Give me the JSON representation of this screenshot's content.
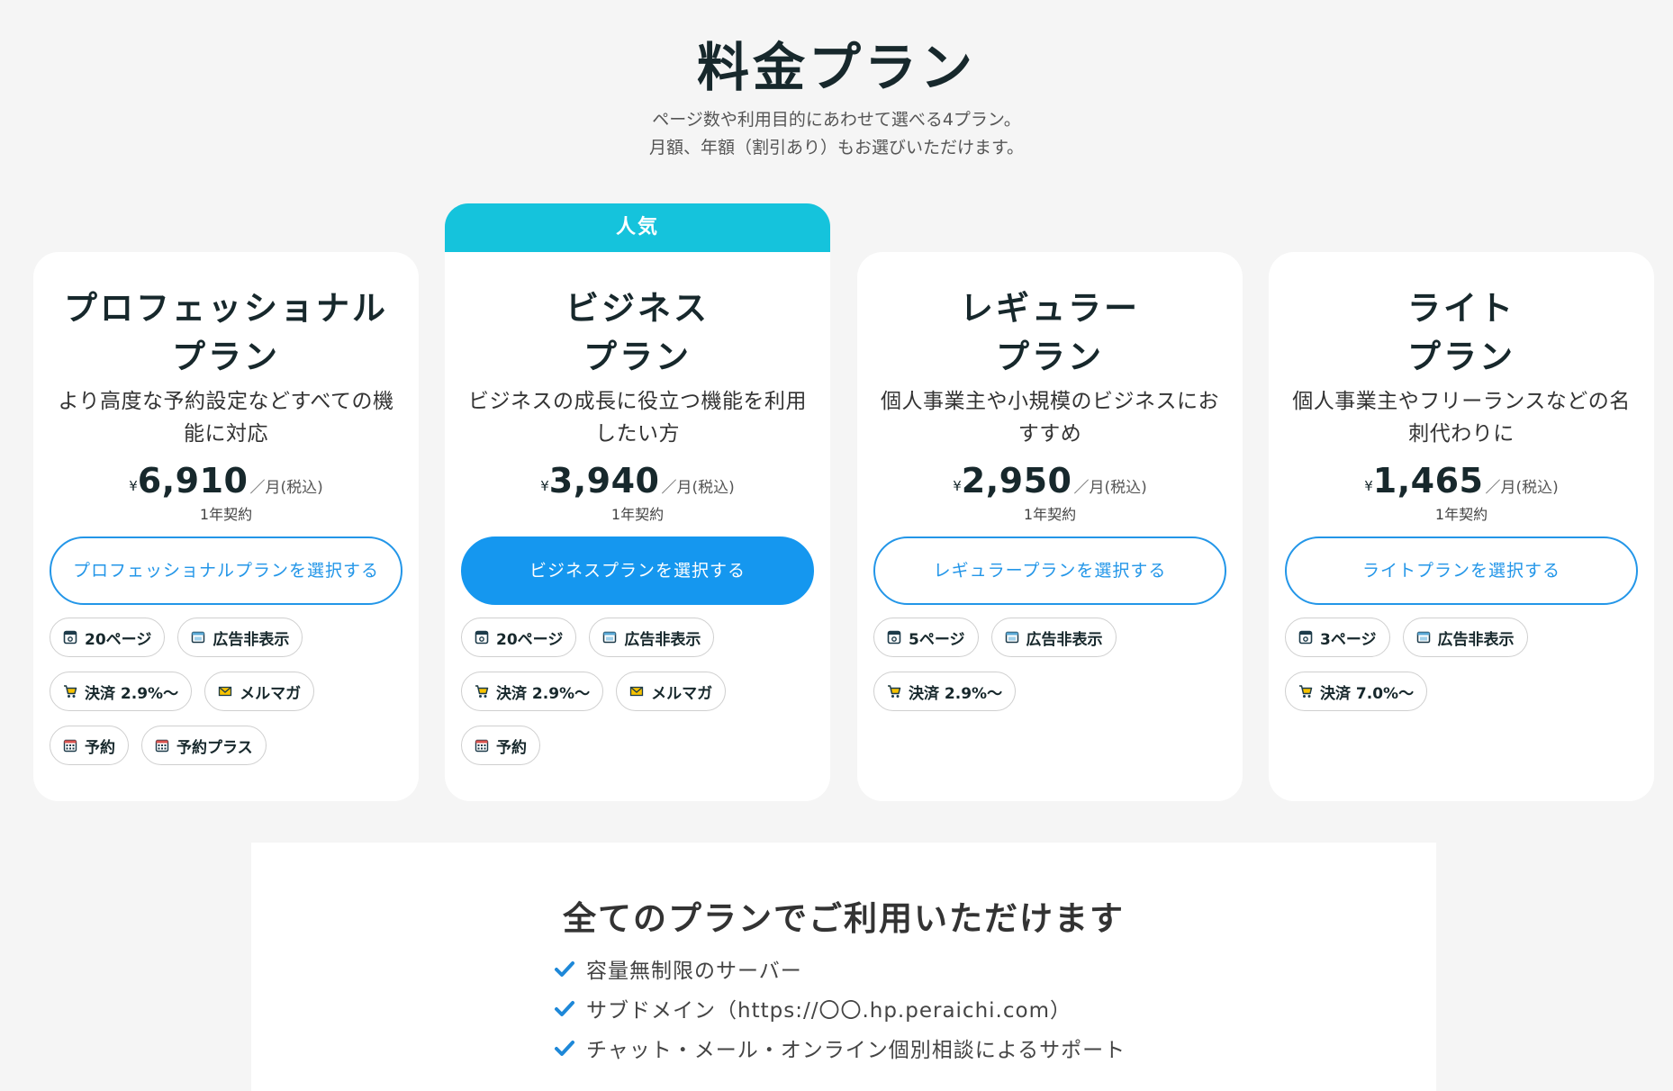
{
  "header": {
    "title": "料金プラン",
    "subtitle_line1": "ページ数や利用目的にあわせて選べる4プラン。",
    "subtitle_line2": "月額、年額（割引あり）もお選びいただけます。"
  },
  "colors": {
    "accent_blue": "#1597ef",
    "popular_cyan": "#15c3dc",
    "check_blue": "#1e88d8"
  },
  "popular_badge": "人気",
  "plans": [
    {
      "name_line1": "プロフェッショナル",
      "name_line2": "プラン",
      "description": "より高度な予約設定などすべての機能に対応",
      "currency": "¥",
      "price": "6,910",
      "unit": "／月(税込)",
      "contract": "1年契約",
      "button_label": "プロフェッショナルプランを選択する",
      "features": [
        {
          "icon": "page-icon",
          "label": "20ページ"
        },
        {
          "icon": "ad-icon",
          "label": "広告非表示"
        },
        {
          "icon": "cart-icon",
          "label": "決済 2.9%〜"
        },
        {
          "icon": "mail-icon",
          "label": "メルマガ"
        },
        {
          "icon": "calendar-icon",
          "label": "予約"
        },
        {
          "icon": "calendar-icon",
          "label": "予約プラス"
        }
      ]
    },
    {
      "name_line1": "ビジネス",
      "name_line2": "プラン",
      "description": "ビジネスの成長に役立つ機能を利用したい方",
      "currency": "¥",
      "price": "3,940",
      "unit": "／月(税込)",
      "contract": "1年契約",
      "button_label": "ビジネスプランを選択する",
      "features": [
        {
          "icon": "page-icon",
          "label": "20ページ"
        },
        {
          "icon": "ad-icon",
          "label": "広告非表示"
        },
        {
          "icon": "cart-icon",
          "label": "決済 2.9%〜"
        },
        {
          "icon": "mail-icon",
          "label": "メルマガ"
        },
        {
          "icon": "calendar-icon",
          "label": "予約"
        }
      ]
    },
    {
      "name_line1": "レギュラー",
      "name_line2": "プラン",
      "description": "個人事業主や小規模のビジネスにおすすめ",
      "currency": "¥",
      "price": "2,950",
      "unit": "／月(税込)",
      "contract": "1年契約",
      "button_label": "レギュラープランを選択する",
      "features": [
        {
          "icon": "page-icon",
          "label": "5ページ"
        },
        {
          "icon": "ad-icon",
          "label": "広告非表示"
        },
        {
          "icon": "cart-icon",
          "label": "決済 2.9%〜"
        }
      ]
    },
    {
      "name_line1": "ライト",
      "name_line2": "プラン",
      "description": "個人事業主やフリーランスなどの名刺代わりに",
      "currency": "¥",
      "price": "1,465",
      "unit": "／月(税込)",
      "contract": "1年契約",
      "button_label": "ライトプランを選択する",
      "features": [
        {
          "icon": "page-icon",
          "label": "3ページ"
        },
        {
          "icon": "ad-icon",
          "label": "広告非表示"
        },
        {
          "icon": "cart-icon",
          "label": "決済 7.0%〜"
        }
      ]
    }
  ],
  "all_plans": {
    "title": "全てのプランでご利用いただけます",
    "items": [
      "容量無制限のサーバー",
      "サブドメイン（https://〇〇.hp.peraichi.com）",
      "チャット・メール・オンライン個別相談によるサポート"
    ],
    "item_icon": "check-icon"
  }
}
